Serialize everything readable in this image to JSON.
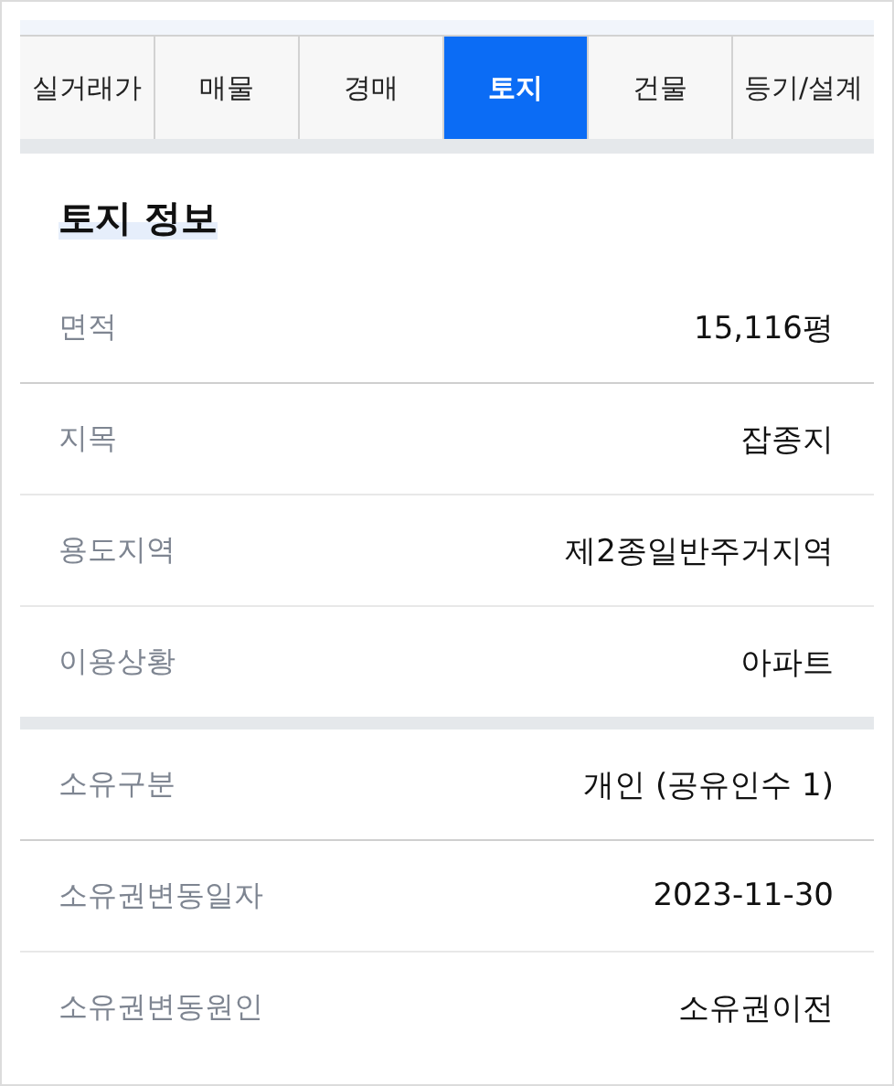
{
  "tabs": [
    {
      "label": "실거래가",
      "selected": false
    },
    {
      "label": "매물",
      "selected": false
    },
    {
      "label": "경매",
      "selected": false
    },
    {
      "label": "토지",
      "selected": true
    },
    {
      "label": "건물",
      "selected": false
    },
    {
      "label": "등기/설계",
      "selected": false
    }
  ],
  "section_title": "토지 정보",
  "groups": [
    {
      "rows": [
        {
          "label": "면적",
          "value": "15,116평"
        },
        {
          "label": "지목",
          "value": "잡종지"
        },
        {
          "label": "용도지역",
          "value": "제2종일반주거지역"
        },
        {
          "label": "이용상황",
          "value": "아파트"
        }
      ]
    },
    {
      "rows": [
        {
          "label": "소유구분",
          "value": "개인 (공유인수 1)"
        },
        {
          "label": "소유권변동일자",
          "value": "2023-11-30"
        },
        {
          "label": "소유권변동원인",
          "value": "소유권이전"
        }
      ]
    }
  ]
}
